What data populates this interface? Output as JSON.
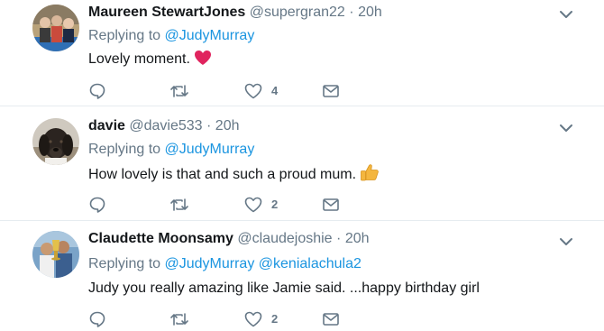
{
  "tweets": [
    {
      "name": "Maureen StewartJones",
      "handle": "@supergran22",
      "separator": "·",
      "time": "20h",
      "replying_prefix": "Replying to",
      "mentions": [
        "@JudyMurray"
      ],
      "text": "Lovely moment.",
      "emoji": "heart-emoji",
      "like_count": "4",
      "icons": [
        "reply-icon",
        "retweet-icon",
        "like-icon",
        "message-icon",
        "chevron-down-icon"
      ]
    },
    {
      "name": "davie",
      "handle": "@davie533",
      "separator": "·",
      "time": "20h",
      "replying_prefix": "Replying to",
      "mentions": [
        "@JudyMurray"
      ],
      "text": "How lovely is that and such a proud mum.",
      "emoji": "thumbs-up-emoji",
      "like_count": "2",
      "icons": [
        "reply-icon",
        "retweet-icon",
        "like-icon",
        "message-icon",
        "chevron-down-icon"
      ]
    },
    {
      "name": "Claudette Moonsamy",
      "handle": "@claudejoshie",
      "separator": "·",
      "time": "20h",
      "replying_prefix": "Replying to",
      "mentions": [
        "@JudyMurray",
        "@kenialachula2"
      ],
      "text": "Judy you really amazing like Jamie said. ...happy birthday girl",
      "like_count": "2",
      "icons": [
        "reply-icon",
        "retweet-icon",
        "like-icon",
        "message-icon",
        "chevron-down-icon"
      ]
    }
  ],
  "colors": {
    "text": "#14171a",
    "secondary": "#657786",
    "link": "#1b95e0",
    "divider": "#e6ecf0",
    "heart": "#e0245e",
    "thumbs": "#f4b63f"
  }
}
